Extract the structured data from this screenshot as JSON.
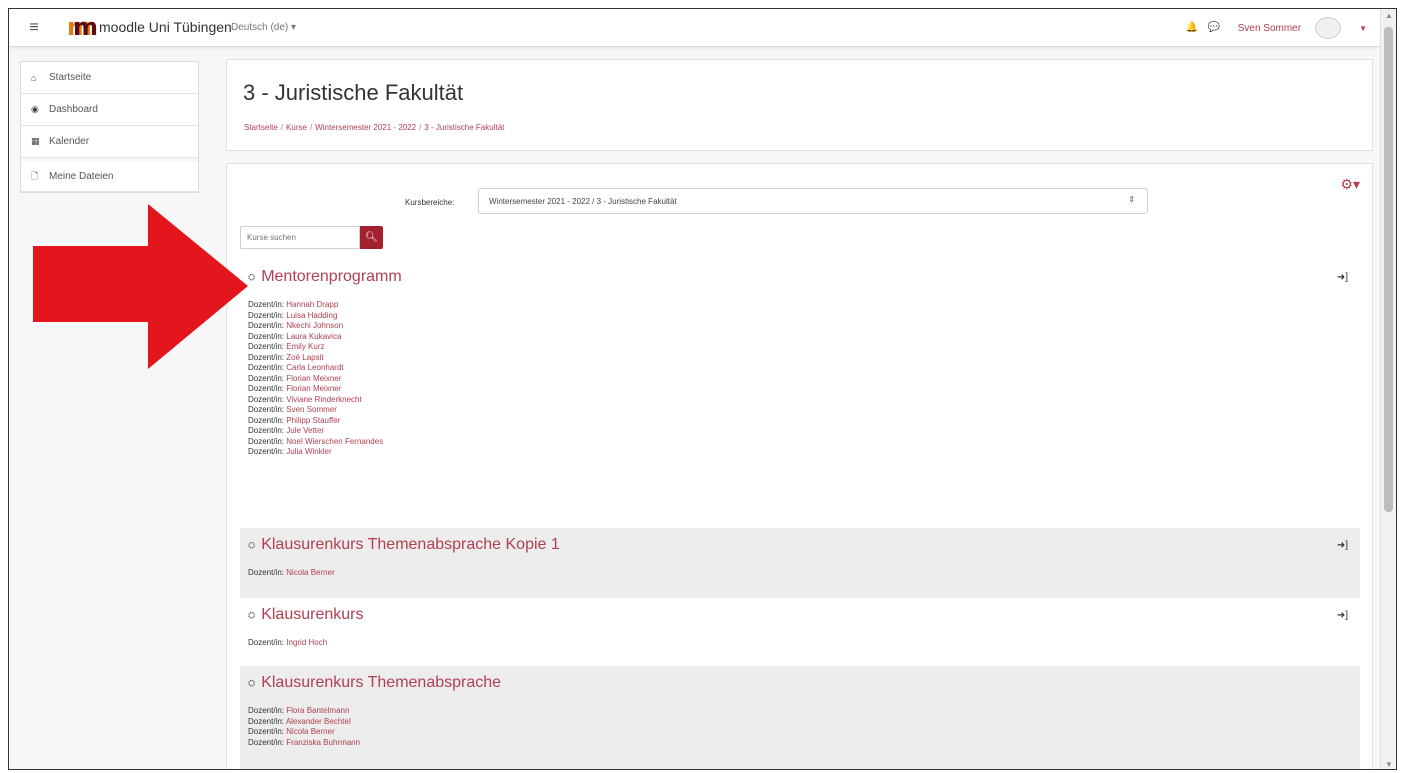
{
  "navbar": {
    "brand": "moodle Uni Tübingen",
    "language": "Deutsch (de) ▾",
    "user": "Sven Sommer"
  },
  "sidebar": {
    "items": [
      {
        "label": "Startseite",
        "icon": "home-icon"
      },
      {
        "label": "Dashboard",
        "icon": "dashboard-icon"
      },
      {
        "label": "Kalender",
        "icon": "calendar-icon"
      },
      {
        "label": "Meine Dateien",
        "icon": "file-icon"
      }
    ]
  },
  "header": {
    "title": "3 - Juristische Fakultät",
    "breadcrumb": [
      "Startseite",
      "Kurse",
      "Wintersemester 2021 - 2022",
      "3 - Juristische Fakultät"
    ]
  },
  "category_select": {
    "label": "Kursbereiche:",
    "value": "Wintersemester 2021 - 2022 / 3 - Juristische Fakultät"
  },
  "search": {
    "placeholder": "Kurse suchen"
  },
  "teacher_prefix": "Dozent/in:",
  "courses": [
    {
      "title": "Mentorenprogramm",
      "teachers": [
        "Hannah Drapp",
        "Luisa Hadding",
        "Nkechi Johnson",
        "Laura Kukavica",
        "Emily Kurz",
        "Zoë Lapsit",
        "Carla Leonhardt",
        "Florian Meixner",
        "Florian Meixner",
        "Viviane Rinderknecht",
        "Sven Sommer",
        "Philipp Stauffer",
        "Jule Vetter",
        "Noel Wierschen Fernandes",
        "Julia Winkler"
      ]
    },
    {
      "title": "Klausurenkurs Themenabsprache Kopie 1",
      "teachers": [
        "Nicola Berner"
      ]
    },
    {
      "title": "Klausurenkurs",
      "teachers": [
        "Ingrid Hoch"
      ]
    },
    {
      "title": "Klausurenkurs Themenabsprache",
      "teachers": [
        "Flora Bantelmann",
        "Alexander Bechtel",
        "Nicola Berner",
        "Franziska Buhrmann"
      ]
    }
  ],
  "colors": {
    "accent": "#b04052",
    "button": "#a3202f",
    "arrow": "#e3161d"
  }
}
